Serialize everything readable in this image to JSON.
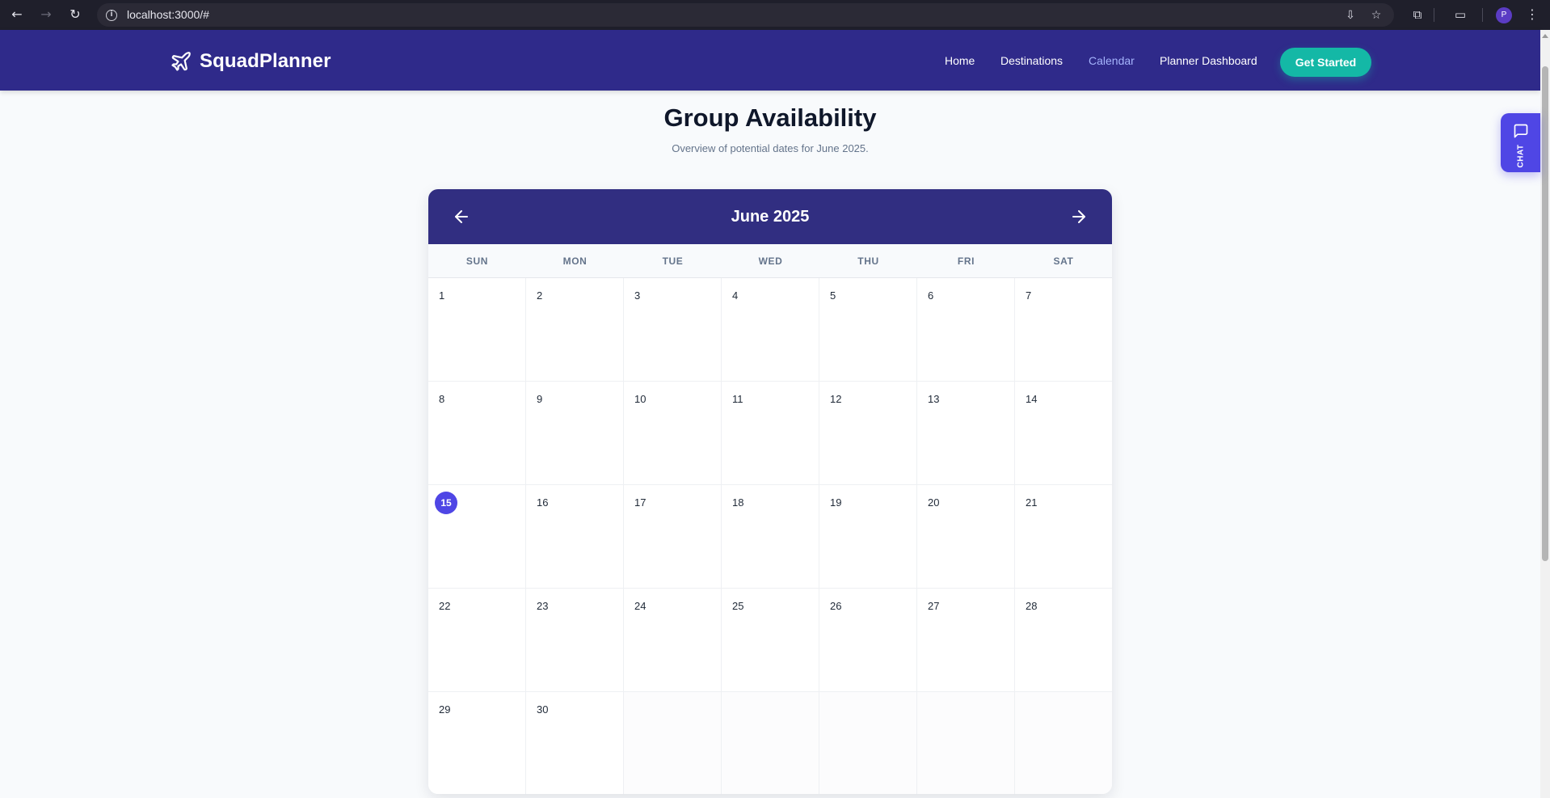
{
  "browser": {
    "url": "localhost:3000/#",
    "profile_initial": "P"
  },
  "header": {
    "brand": "SquadPlanner",
    "nav": [
      {
        "label": "Home",
        "active": false
      },
      {
        "label": "Destinations",
        "active": false
      },
      {
        "label": "Calendar",
        "active": true
      },
      {
        "label": "Planner Dashboard",
        "active": false
      }
    ],
    "cta_label": "Get Started"
  },
  "page": {
    "title": "Group Availability",
    "subtitle": "Overview of potential dates for June 2025."
  },
  "chat": {
    "label": "CHAT"
  },
  "calendar": {
    "month_label": "June 2025",
    "weekdays": [
      "SUN",
      "MON",
      "TUE",
      "WED",
      "THU",
      "FRI",
      "SAT"
    ],
    "today": 15,
    "days": [
      1,
      2,
      3,
      4,
      5,
      6,
      7,
      8,
      9,
      10,
      11,
      12,
      13,
      14,
      15,
      16,
      17,
      18,
      19,
      20,
      21,
      22,
      23,
      24,
      25,
      26,
      27,
      28,
      29,
      30
    ],
    "trailing_empty_cells": 5
  },
  "colors": {
    "header_bg": "#2f2a8a",
    "calendar_header_bg": "#312e81",
    "accent": "#4f46e5",
    "cta": "#14b8a6",
    "active_nav": "#a5b4fc"
  }
}
